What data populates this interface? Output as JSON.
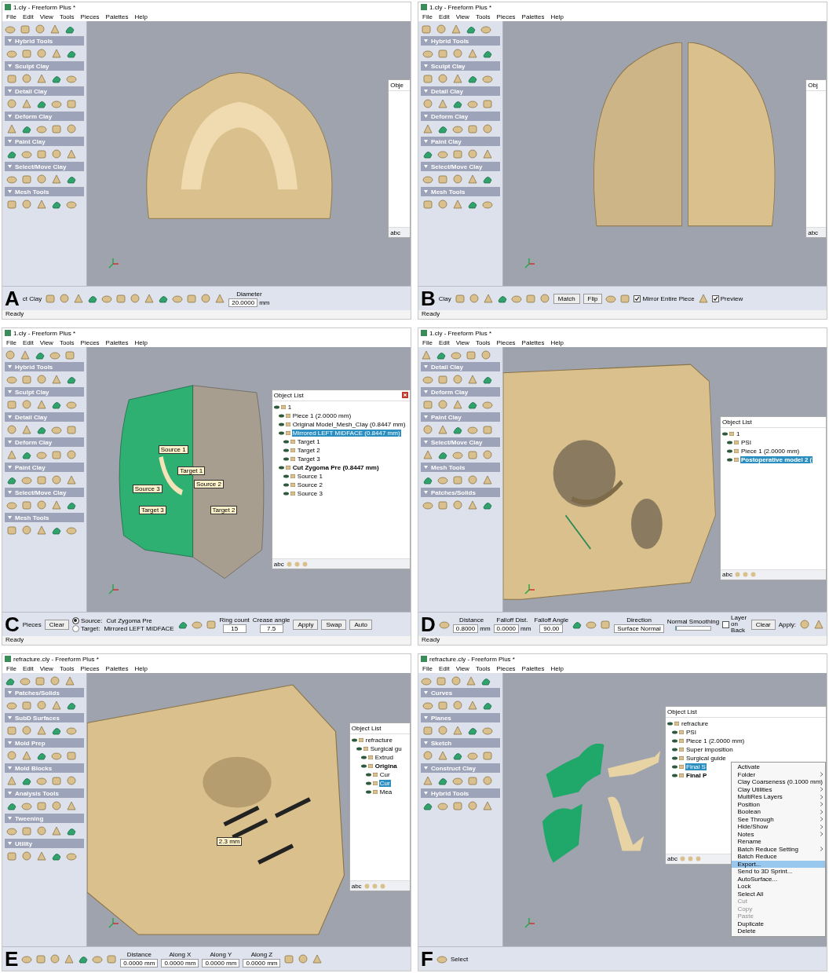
{
  "panels": [
    {
      "letter": "A",
      "title": "1.cly - Freeform Plus *",
      "menu": [
        "File",
        "Edit",
        "View",
        "Tools",
        "Pieces",
        "Palettes",
        "Help"
      ],
      "palette": [
        "Hybrid Tools",
        "Sculpt Clay",
        "Detail Clay",
        "Deform Clay",
        "Paint Clay",
        "Select/Move Clay",
        "Mesh Tools"
      ],
      "model": {
        "kind": "skull-base"
      },
      "object_list": {
        "title": "Obje",
        "closable": false,
        "footer": "abc"
      },
      "toolbar": [
        {
          "kind": "label",
          "text": "ct Clay"
        },
        {
          "kind": "tool"
        },
        {
          "kind": "tool"
        },
        {
          "kind": "tool"
        },
        {
          "kind": "tool"
        },
        {
          "kind": "tool"
        },
        {
          "kind": "tool"
        },
        {
          "kind": "tool"
        },
        {
          "kind": "tool"
        },
        {
          "kind": "tool"
        },
        {
          "kind": "tool"
        },
        {
          "kind": "tool"
        },
        {
          "kind": "tool"
        },
        {
          "kind": "tool"
        },
        {
          "kind": "field",
          "label": "Diameter",
          "value": "20.0000",
          "unit": "mm"
        }
      ],
      "status": "Ready"
    },
    {
      "letter": "B",
      "title": "1.cly - Freeform Plus *",
      "menu": [
        "File",
        "Edit",
        "View",
        "Tools",
        "Pieces",
        "Palettes",
        "Help"
      ],
      "palette": [
        "Hybrid Tools",
        "Sculpt Clay",
        "Detail Clay",
        "Deform Clay",
        "Paint Clay",
        "Select/Move Clay",
        "Mesh Tools"
      ],
      "model": {
        "kind": "split-skull"
      },
      "object_list": {
        "title": "Obj",
        "closable": false,
        "footer": "abc"
      },
      "toolbar": [
        {
          "kind": "label",
          "text": "Clay"
        },
        {
          "kind": "tool"
        },
        {
          "kind": "tool"
        },
        {
          "kind": "tool"
        },
        {
          "kind": "tool"
        },
        {
          "kind": "tool"
        },
        {
          "kind": "tool"
        },
        {
          "kind": "tool"
        },
        {
          "kind": "button",
          "text": "Match"
        },
        {
          "kind": "button",
          "text": "Flip"
        },
        {
          "kind": "tool"
        },
        {
          "kind": "tool"
        },
        {
          "kind": "checkbox",
          "text": "Mirror Entire Piece",
          "checked": true
        },
        {
          "kind": "tool"
        },
        {
          "kind": "checkbox",
          "text": "Preview",
          "checked": true
        }
      ],
      "status": "Ready"
    },
    {
      "letter": "C",
      "title": "1.cly - Freeform Plus *",
      "menu": [
        "File",
        "Edit",
        "View",
        "Tools",
        "Pieces",
        "Palettes",
        "Help"
      ],
      "palette": [
        "Hybrid Tools",
        "Sculpt Clay",
        "Detail Clay",
        "Deform Clay",
        "Paint Clay",
        "Select/Move Clay",
        "Mesh Tools"
      ],
      "model": {
        "kind": "mirrored-skull",
        "tags": [
          "Source 1",
          "Target 1",
          "Source 3",
          "Target 3",
          "Source 2",
          "Target 2"
        ]
      },
      "object_list": {
        "title": "Object List",
        "closable": true,
        "footer": "abc",
        "items": [
          {
            "label": "1",
            "selected": false,
            "bold": false,
            "children": [
              {
                "label": "Piece 1 (2.0000 mm)",
                "selected": false,
                "bold": false
              },
              {
                "label": "Original Model_Mesh_Clay (0.8447 mm)",
                "selected": false,
                "bold": false
              },
              {
                "label": "Mirrored LEFT MIDFACE  (0.8447 mm)",
                "selected": true,
                "bold": false,
                "children": [
                  {
                    "label": "Target 1",
                    "selected": false,
                    "bold": false
                  },
                  {
                    "label": "Target 2",
                    "selected": false,
                    "bold": false
                  },
                  {
                    "label": "Target 3",
                    "selected": false,
                    "bold": false
                  }
                ]
              },
              {
                "label": "Cut Zygoma Pre (0.8447 mm)",
                "selected": false,
                "bold": true,
                "children": [
                  {
                    "label": "Source 1",
                    "selected": false,
                    "bold": false
                  },
                  {
                    "label": "Source 2",
                    "selected": false,
                    "bold": false
                  },
                  {
                    "label": "Source 3",
                    "selected": false,
                    "bold": false
                  }
                ]
              }
            ]
          }
        ]
      },
      "toolbar": [
        {
          "kind": "label",
          "text": "Pieces"
        },
        {
          "kind": "button",
          "text": "Clear"
        },
        {
          "kind": "radio",
          "text": "Source:",
          "value": "Cut Zygoma Pre",
          "selected": true
        },
        {
          "kind": "radio",
          "text": "Target:",
          "value": "Mirrored LEFT MIDFACE",
          "selected": false
        },
        {
          "kind": "tool"
        },
        {
          "kind": "tool"
        },
        {
          "kind": "tool"
        },
        {
          "kind": "field",
          "label": "Ring count",
          "value": "15"
        },
        {
          "kind": "field",
          "label": "Crease angle",
          "value": "7.5"
        },
        {
          "kind": "button",
          "text": "Apply"
        },
        {
          "kind": "button",
          "text": "Swap"
        },
        {
          "kind": "button",
          "text": "Auto"
        }
      ],
      "status": "Ready"
    },
    {
      "letter": "D",
      "title": "1.cly - Freeform Plus *",
      "menu": [
        "File",
        "Edit",
        "View",
        "Tools",
        "Pieces",
        "Palettes",
        "Help"
      ],
      "palette": [
        "Detail Clay",
        "Deform Clay",
        "Paint Clay",
        "Select/Move Clay",
        "Mesh Tools",
        "Patches/Solids"
      ],
      "model": {
        "kind": "skull-front"
      },
      "object_list": {
        "title": "Object List",
        "closable": false,
        "footer": "abc",
        "items": [
          {
            "label": "1",
            "selected": false,
            "bold": false,
            "children": [
              {
                "label": "PSI",
                "selected": false,
                "bold": false
              },
              {
                "label": "Piece 1 (2.0000 mm)",
                "selected": false,
                "bold": false
              },
              {
                "label": "Postoperative model 2 (",
                "selected": true,
                "bold": true
              }
            ]
          }
        ]
      },
      "toolbar": [
        {
          "kind": "tool"
        },
        {
          "kind": "field",
          "label": "Distance",
          "value": "0.8000",
          "unit": "mm"
        },
        {
          "kind": "field",
          "label": "Falloff Dist.",
          "value": "0.0000",
          "unit": "mm"
        },
        {
          "kind": "field",
          "label": "Falloff Angle",
          "value": "90.00"
        },
        {
          "kind": "tool"
        },
        {
          "kind": "tool"
        },
        {
          "kind": "tool"
        },
        {
          "kind": "dropdown",
          "label": "Direction",
          "value": "Surface Normal"
        },
        {
          "kind": "slider",
          "label": "Normal Smoothing",
          "level": 0.03
        },
        {
          "kind": "checkbox",
          "text": "Layer on Back",
          "checked": false
        },
        {
          "kind": "button",
          "text": "Clear"
        },
        {
          "kind": "label",
          "text": "Apply:"
        },
        {
          "kind": "tool"
        },
        {
          "kind": "tool"
        }
      ],
      "status": "Ready"
    },
    {
      "letter": "E",
      "title": "refracture.cly - Freeform Plus *",
      "menu": [
        "File",
        "Edit",
        "View",
        "Tools",
        "Pieces",
        "Palettes",
        "Help"
      ],
      "palette": [
        "Patches/Solids",
        "SubD Surfaces",
        "Mold Prep",
        "Mold Blocks",
        "Analysis Tools",
        "Tweening",
        "Utility"
      ],
      "model": {
        "kind": "skull-side",
        "tags": [
          "2.3 mm"
        ]
      },
      "object_list": {
        "title": "Object List",
        "closable": false,
        "footer": "abc",
        "items": [
          {
            "label": "refracture",
            "selected": false,
            "bold": false,
            "children": [
              {
                "label": "Surgical gu",
                "selected": false,
                "bold": false,
                "children": [
                  {
                    "label": "Extrud",
                    "selected": false,
                    "bold": false
                  },
                  {
                    "label": "Origina",
                    "selected": false,
                    "bold": true,
                    "children": [
                      {
                        "label": "Cur",
                        "selected": false,
                        "bold": false
                      },
                      {
                        "label": "Cur",
                        "selected": true,
                        "bold": false
                      },
                      {
                        "label": "Mea",
                        "selected": false,
                        "bold": false
                      }
                    ]
                  }
                ]
              }
            ]
          }
        ]
      },
      "toolbar": [
        {
          "kind": "tool"
        },
        {
          "kind": "tool"
        },
        {
          "kind": "tool"
        },
        {
          "kind": "tool"
        },
        {
          "kind": "tool"
        },
        {
          "kind": "tool"
        },
        {
          "kind": "tool"
        },
        {
          "kind": "field",
          "label": "Distance",
          "value": "0.0000 mm"
        },
        {
          "kind": "field",
          "label": "Along X",
          "value": "0.0000 mm"
        },
        {
          "kind": "field",
          "label": "Along Y",
          "value": "0.0000 mm"
        },
        {
          "kind": "field",
          "label": "Along Z",
          "value": "0.0000 mm"
        },
        {
          "kind": "tool"
        },
        {
          "kind": "tool"
        },
        {
          "kind": "tool"
        }
      ]
    },
    {
      "letter": "F",
      "title": "refracture.cly - Freeform Plus *",
      "menu": [
        "File",
        "Edit",
        "View",
        "Tools",
        "Pieces",
        "Palettes",
        "Help"
      ],
      "palette": [
        "Curves",
        "Planes",
        "Sketch",
        "Construct Clay",
        "Hybrid Tools"
      ],
      "model": {
        "kind": "guides-plates"
      },
      "object_list": {
        "title": "Object List",
        "closable": false,
        "footer": "abc",
        "items": [
          {
            "label": "refracture",
            "selected": false,
            "bold": false,
            "children": [
              {
                "label": "PSI",
                "selected": false,
                "bold": false
              },
              {
                "label": "Piece 1 (2.0000 mm)",
                "selected": false,
                "bold": false
              },
              {
                "label": "Super imposition",
                "selected": false,
                "bold": false
              },
              {
                "label": "Surgical guide",
                "selected": false,
                "bold": false
              },
              {
                "label": "Final S",
                "selected": true,
                "bold": false
              },
              {
                "label": "Final P",
                "selected": false,
                "bold": true
              }
            ]
          }
        ]
      },
      "context_menu": [
        {
          "label": "Activate",
          "submenu": false,
          "selected": false,
          "disabled": false
        },
        {
          "label": "Folder",
          "submenu": true,
          "selected": false,
          "disabled": false
        },
        {
          "label": "Clay Coarseness (0.1000 mm)",
          "submenu": false,
          "selected": false,
          "disabled": false
        },
        {
          "label": "Clay Utilities",
          "submenu": true,
          "selected": false,
          "disabled": false
        },
        {
          "label": "MultiRes Layers",
          "submenu": true,
          "selected": false,
          "disabled": false
        },
        {
          "label": "Position",
          "submenu": true,
          "selected": false,
          "disabled": false
        },
        {
          "label": "Boolean",
          "submenu": true,
          "selected": false,
          "disabled": false
        },
        {
          "label": "See Through",
          "submenu": true,
          "selected": false,
          "disabled": false
        },
        {
          "label": "Hide/Show",
          "submenu": true,
          "selected": false,
          "disabled": false
        },
        {
          "label": "Notes",
          "submenu": true,
          "selected": false,
          "disabled": false
        },
        {
          "label": "Rename",
          "submenu": false,
          "selected": false,
          "disabled": false
        },
        {
          "label": "Batch Reduce Setting",
          "submenu": true,
          "selected": false,
          "disabled": false
        },
        {
          "label": "Batch Reduce",
          "submenu": false,
          "selected": false,
          "disabled": false
        },
        {
          "label": "Export...",
          "submenu": false,
          "selected": true,
          "disabled": false
        },
        {
          "label": "Send to 3D Sprint...",
          "submenu": false,
          "selected": false,
          "disabled": false
        },
        {
          "label": "AutoSurface...",
          "submenu": false,
          "selected": false,
          "disabled": false
        },
        {
          "label": "Lock",
          "submenu": false,
          "selected": false,
          "disabled": false
        },
        {
          "label": "Select All",
          "submenu": false,
          "selected": false,
          "disabled": false
        },
        {
          "label": "Cut",
          "submenu": false,
          "selected": false,
          "disabled": true
        },
        {
          "label": "Copy",
          "submenu": false,
          "selected": false,
          "disabled": true
        },
        {
          "label": "Paste",
          "submenu": false,
          "selected": false,
          "disabled": true
        },
        {
          "label": "Duplicate",
          "submenu": false,
          "selected": false,
          "disabled": false
        },
        {
          "label": "Delete",
          "submenu": false,
          "selected": false,
          "disabled": false
        }
      ],
      "toolbar": [
        {
          "kind": "tool"
        },
        {
          "kind": "label",
          "text": "Select"
        }
      ]
    }
  ]
}
